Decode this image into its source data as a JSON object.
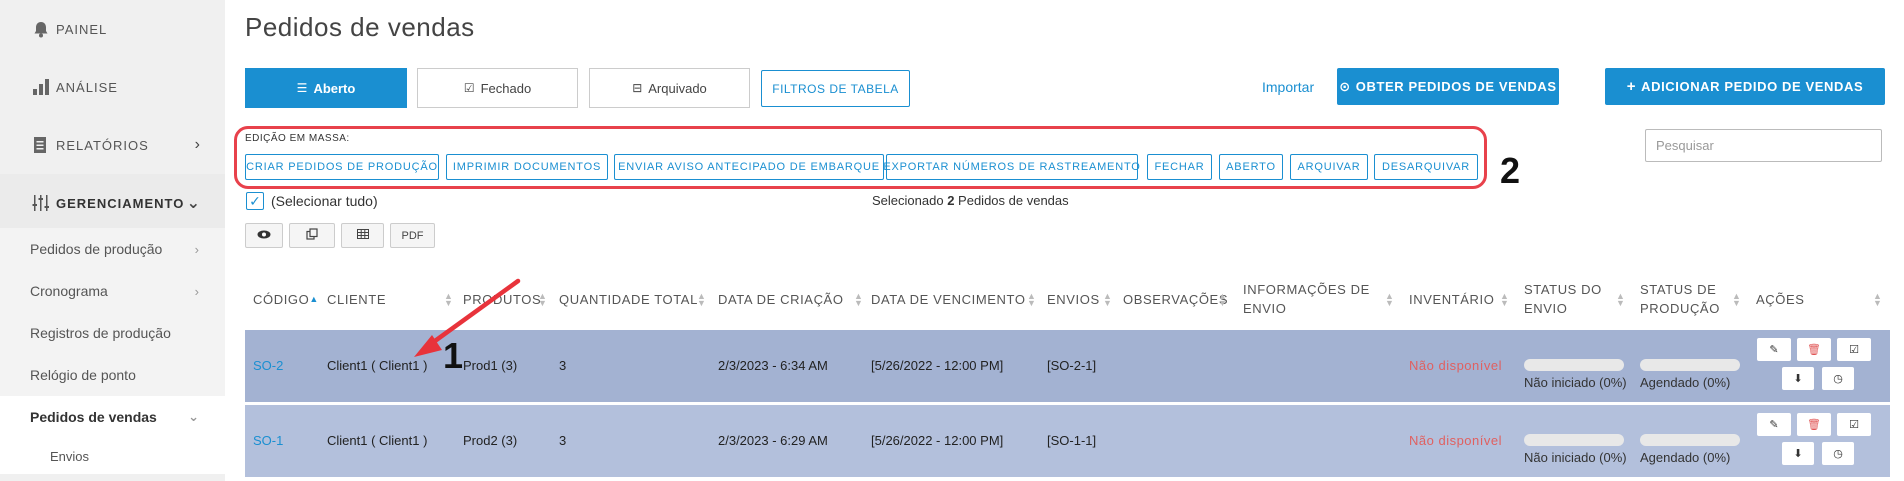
{
  "sidebar": {
    "painel": "PAINEL",
    "analise": "ANÁLISE",
    "relatorios": "RELATÓRIOS",
    "gerenciamento": "GERENCIAMENTO",
    "items": [
      {
        "label": "Pedidos de produção"
      },
      {
        "label": "Cronograma"
      },
      {
        "label": "Registros de produção"
      },
      {
        "label": "Relógio de ponto"
      },
      {
        "label": "Pedidos de vendas"
      },
      {
        "label": "Envios"
      }
    ]
  },
  "page": {
    "title": "Pedidos de vendas"
  },
  "tabs": {
    "aberto": "Aberto",
    "fechado": "Fechado",
    "arquivado": "Arquivado"
  },
  "toolbar": {
    "filtros": "FILTROS DE TABELA",
    "importar": "Importar",
    "obter": "OBTER PEDIDOS DE VENDAS",
    "adicionar": "ADICIONAR PEDIDO DE VENDAS"
  },
  "bulk": {
    "label": "EDIÇÃO EM MASSA:",
    "buttons": [
      "CRIAR PEDIDOS DE PRODUÇÃO",
      "IMPRIMIR DOCUMENTOS",
      "ENVIAR AVISO ANTECIPADO DE EMBARQUE",
      "EXPORTAR NÚMEROS DE RASTREAMENTO",
      "FECHAR",
      "ABERTO",
      "ARQUIVAR",
      "DESARQUIVAR"
    ]
  },
  "search": {
    "placeholder": "Pesquisar"
  },
  "selection": {
    "select_all": "(Selecionar tudo)",
    "prefix": "Selecionado",
    "count": "2",
    "suffix": "Pedidos de vendas"
  },
  "tools": {
    "pdf": "PDF"
  },
  "annotations": {
    "one": "1",
    "two": "2"
  },
  "table": {
    "headers": {
      "codigo": "CÓDIGO",
      "cliente": "CLIENTE",
      "produtos": "PRODUTOS",
      "quantidade": "QUANTIDADE TOTAL",
      "criacao": "DATA DE CRIAÇÃO",
      "vencimento": "DATA DE VENCIMENTO",
      "envios": "ENVIOS",
      "observacoes": "OBSERVAÇÕES",
      "info_envio_1": "INFORMAÇÕES DE",
      "info_envio_2": "ENVIO",
      "inventario": "INVENTÁRIO",
      "status_envio_1": "STATUS DO",
      "status_envio_2": "ENVIO",
      "status_prod_1": "STATUS DE",
      "status_prod_2": "PRODUÇÃO",
      "acoes": "AÇÕES"
    },
    "rows": [
      {
        "code": "SO-2",
        "client": "Client1 ( Client1 )",
        "products": "Prod1 (3)",
        "qty": "3",
        "created": "2/3/2023 - 6:34 AM",
        "due": "[5/26/2022 - 12:00 PM]",
        "shipments": "[SO-2-1]",
        "inventory": "Não disponível",
        "ship_status": "Não iniciado (0%)",
        "ship_progress": 0,
        "prod_status": "Agendado (0%)",
        "prod_progress": 0
      },
      {
        "code": "SO-1",
        "client": "Client1 ( Client1 )",
        "products": "Prod2 (3)",
        "qty": "3",
        "created": "2/3/2023 - 6:29 AM",
        "due": "[5/26/2022 - 12:00 PM]",
        "shipments": "[SO-1-1]",
        "inventory": "Não disponível",
        "ship_status": "Não iniciado (0%)",
        "ship_progress": 0,
        "prod_status": "Agendado (0%)",
        "prod_progress": 0
      }
    ]
  },
  "colors": {
    "accent": "#1a8fd1",
    "annotation_red": "#e8414b",
    "row1": "#a3b2d2",
    "row2": "#b3c0dc"
  },
  "icons": [
    "bell-icon",
    "bar-chart-icon",
    "document-icon",
    "sliders-icon",
    "list-icon",
    "check-square-icon",
    "inbox-icon",
    "download-circle-icon",
    "plus-icon",
    "eye-icon",
    "copy-icon",
    "table-icon",
    "edit-icon",
    "trash-icon",
    "check-icon",
    "download-icon",
    "clock-icon"
  ]
}
